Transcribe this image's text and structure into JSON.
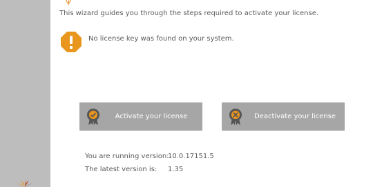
{
  "intro_text": "This wizard guides you through the steps required to activate your license.",
  "warning": {
    "text": "No license key was found on your system.",
    "icon": "warning-octagon-icon",
    "color": "#e8961e"
  },
  "buttons": {
    "activate_label": "Activate your license",
    "deactivate_label": "Deactivate your license",
    "activate_icon": "license-check-badge-icon",
    "deactivate_icon": "license-remove-badge-icon"
  },
  "version_info": {
    "running_label": "You are running version:",
    "running_value": "10.0.17151.5",
    "latest_label": "The latest version is:",
    "latest_value": "1.35"
  },
  "colors": {
    "sidebar": "#bdbdbd",
    "button": "#a6a6a6",
    "accent": "#e8961e"
  }
}
